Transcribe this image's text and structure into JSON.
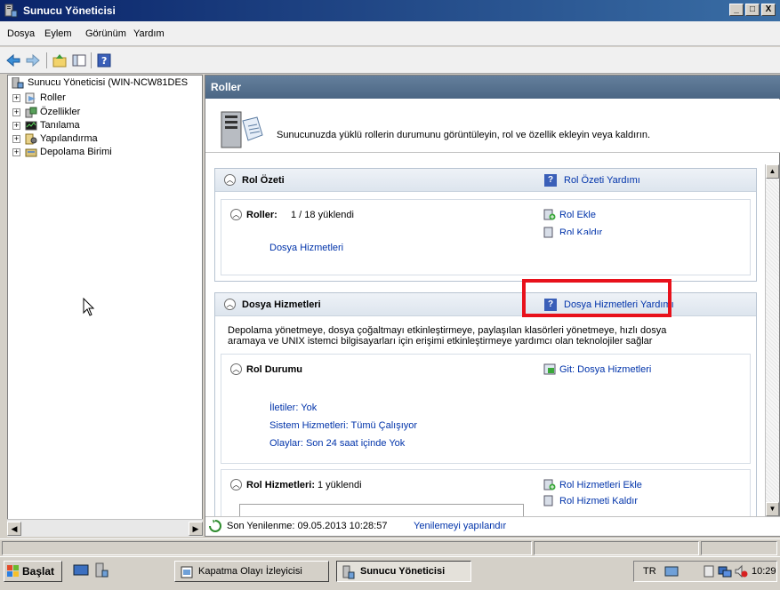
{
  "window": {
    "title": "Sunucu Yöneticisi",
    "controls": [
      "_",
      "□",
      "X"
    ]
  },
  "menu": [
    "Dosya",
    "Eylem",
    "Görünüm",
    "Yardım"
  ],
  "tree": {
    "root": "Sunucu Yöneticisi (WIN-NCW81DES",
    "items": [
      {
        "label": "Roller"
      },
      {
        "label": "Özellikler"
      },
      {
        "label": "Tanılama"
      },
      {
        "label": "Yapılandırma"
      },
      {
        "label": "Depolama Birimi"
      }
    ]
  },
  "pane": {
    "header": "Roller",
    "intro": "Sunucunuzda yüklü rollerin durumunu görüntüleyin, rol ve özellik ekleyin veya kaldırın."
  },
  "rol_ozeti": {
    "title": "Rol Özeti",
    "help": "Rol Özeti Yardımı",
    "roller_label": "Roller:",
    "roller_value": "1 / 18 yüklendi",
    "role_item": "Dosya Hizmetleri",
    "add_role": "Rol Ekle",
    "remove_role": "Rol Kaldır"
  },
  "dosya_hizmetleri": {
    "title": "Dosya Hizmetleri",
    "help": "Dosya Hizmetleri Yardımı",
    "description_line1": "Depolama yönetmeye, dosya çoğaltmayı etkinleştirmeye, paylaşılan klasörleri yönetmeye, hızlı dosya",
    "description_line2": "aramaya ve UNIX istemci bilgisayarları için erişimi etkinleştirmeye yardımcı olan teknolojiler sağlar",
    "rol_durumu_title": "Rol Durumu",
    "goto": "Git: Dosya Hizmetleri",
    "status_messages": "İletiler: Yok",
    "status_services": "Sistem Hizmetleri: Tümü Çalışıyor",
    "status_events": "Olaylar: Son 24 saat içinde Yok",
    "rol_hizmetleri_label": "Rol Hizmetleri:",
    "rol_hizmetleri_value": "1 yüklendi",
    "add_role_services": "Rol Hizmetleri Ekle",
    "remove_role_services": "Rol Hizmeti Kaldır"
  },
  "refresh": {
    "text": "Son Yenilenme: 09.05.2013 10:28:57",
    "link": "Yenilemeyi yapılandır"
  },
  "taskbar": {
    "start": "Başlat",
    "tasks": [
      "Kapatma Olayı İzleyicisi",
      "Sunucu Yöneticisi"
    ],
    "lang": "TR",
    "clock": "10:29"
  },
  "colors": {
    "highlight": "#e8111b",
    "link": "#0033aa",
    "header": "#4b6684"
  }
}
